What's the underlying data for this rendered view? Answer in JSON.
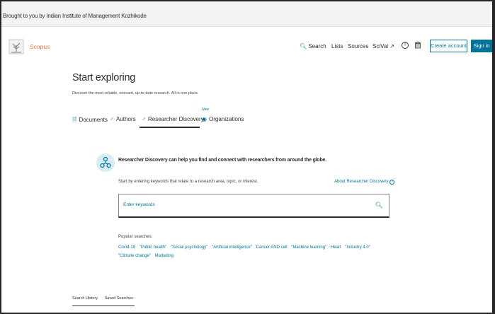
{
  "banner": {
    "text": "Brought to you by Indian Institute of Management Kozhikode"
  },
  "header": {
    "brand": "Scopus",
    "nav": [
      {
        "label": "Search",
        "icon": "search-icon"
      },
      {
        "label": "Lists"
      },
      {
        "label": "Sources"
      },
      {
        "label": "SciVal ↗"
      }
    ],
    "create_account": "Create account",
    "sign_in": "Sign in"
  },
  "main": {
    "title": "Start exploring",
    "subtitle": "Discover the most reliable, relevant, up-to-date research. All in one place.",
    "tabs": [
      {
        "label": "Documents",
        "icon": "document-icon"
      },
      {
        "label": "Authors",
        "icon": "person-icon"
      },
      {
        "label": "Researcher Discovery",
        "icon": "network-icon",
        "active": true
      },
      {
        "label": "Organizations",
        "icon": "building-icon"
      }
    ],
    "new_badge": "New"
  },
  "researcher": {
    "headline": "Researcher Discovery can help you find and connect with researchers from around the globe.",
    "hint": "Start by entering keywords that relate to a research area, topic, or interest.",
    "about_link": "About Researcher Discovery",
    "placeholder": "Enter keywords"
  },
  "popular": {
    "label": "Popular searches:",
    "items": [
      "Covid-19",
      "\"Public health\"",
      "\"Social psychology\"",
      "\"Artificial intelligence\"",
      "Cancer AND cell",
      "\"Machine learning\"",
      "Heart",
      "\"Industry 4.0\"",
      "\"Climate change\"",
      "Marketing"
    ]
  },
  "bottom": {
    "tabs": [
      "Search History",
      "Saved Searches"
    ]
  },
  "colors": {
    "accent": "#007398",
    "brand": "#e8734b"
  }
}
